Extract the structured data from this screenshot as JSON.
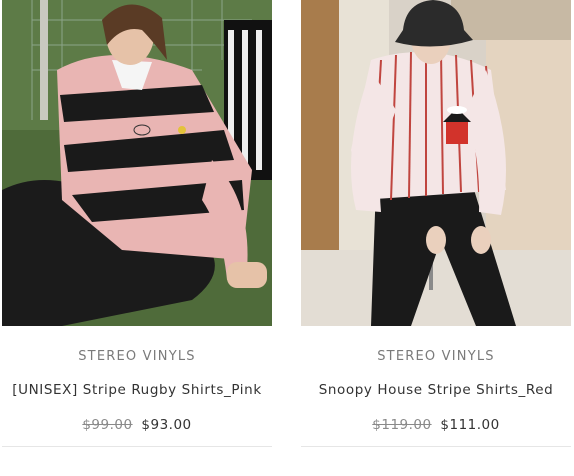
{
  "products": [
    {
      "brand": "STEREO VINYLS",
      "title": "[UNISEX] Stripe Rugby Shirts_Pink",
      "old_price": "$99.00",
      "price": "$93.00"
    },
    {
      "brand": "STEREO VINYLS",
      "title": "Snoopy House Stripe Shirts_Red",
      "old_price": "$119.00",
      "price": "$111.00"
    }
  ],
  "colors": {
    "brand_text": "#7a7a7a",
    "title_text": "#333333",
    "old_price_text": "#8a8a8a"
  }
}
